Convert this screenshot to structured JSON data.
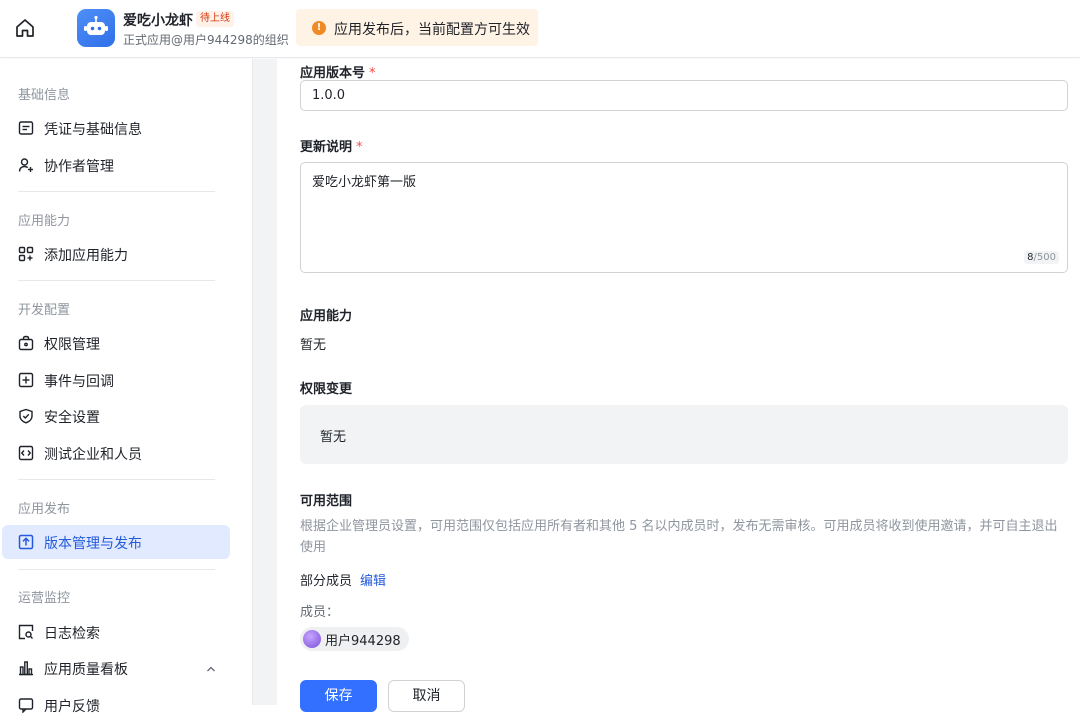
{
  "header": {
    "app_name": "爱吃小龙虾",
    "status_badge": "待上线",
    "org_line": "正式应用@用户944298的组织",
    "notice": "应用发布后，当前配置方可生效",
    "notice_icon": "!"
  },
  "sidebar": {
    "sections": [
      {
        "title": "基础信息",
        "items": [
          {
            "label": "凭证与基础信息",
            "icon": "credential-icon"
          },
          {
            "label": "协作者管理",
            "icon": "add-user-icon"
          }
        ]
      },
      {
        "title": "应用能力",
        "items": [
          {
            "label": "添加应用能力",
            "icon": "grid-add-icon"
          }
        ]
      },
      {
        "title": "开发配置",
        "items": [
          {
            "label": "权限管理",
            "icon": "lock-box-icon"
          },
          {
            "label": "事件与回调",
            "icon": "event-icon"
          },
          {
            "label": "安全设置",
            "icon": "shield-icon"
          },
          {
            "label": "测试企业和人员",
            "icon": "code-box-icon"
          }
        ]
      },
      {
        "title": "应用发布",
        "items": [
          {
            "label": "版本管理与发布",
            "icon": "upload-box-icon",
            "active": true
          }
        ]
      },
      {
        "title": "运营监控",
        "items": [
          {
            "label": "日志检索",
            "icon": "log-search-icon"
          },
          {
            "label": "应用质量看板",
            "icon": "bar-chart-icon"
          },
          {
            "label": "用户反馈",
            "icon": "feedback-icon"
          }
        ]
      }
    ]
  },
  "form": {
    "version_label": "应用版本号",
    "version_value": "1.0.0",
    "required_mark": "*",
    "update_label": "更新说明",
    "update_value": "爱吃小龙虾第一版",
    "counter_current": "8",
    "counter_max": "/500",
    "capability_label": "应用能力",
    "capability_value": "暂无",
    "permission_label": "权限变更",
    "permission_value": "暂无",
    "scope_label": "可用范围",
    "scope_desc": "根据企业管理员设置，可用范围仅包括应用所有者和其他 5 名以内成员时，发布无需审核。可用成员将收到使用邀请，并可自主退出使用",
    "scope_value": "部分成员",
    "scope_edit": "编辑",
    "members_label": "成员：",
    "member_name": "用户944298",
    "save_label": "保存",
    "cancel_label": "取消"
  },
  "colors": {
    "primary": "#3370ff",
    "active_nav_bg": "#e1eaff",
    "notice_bg": "#fff3e6",
    "required": "#f54a45"
  }
}
